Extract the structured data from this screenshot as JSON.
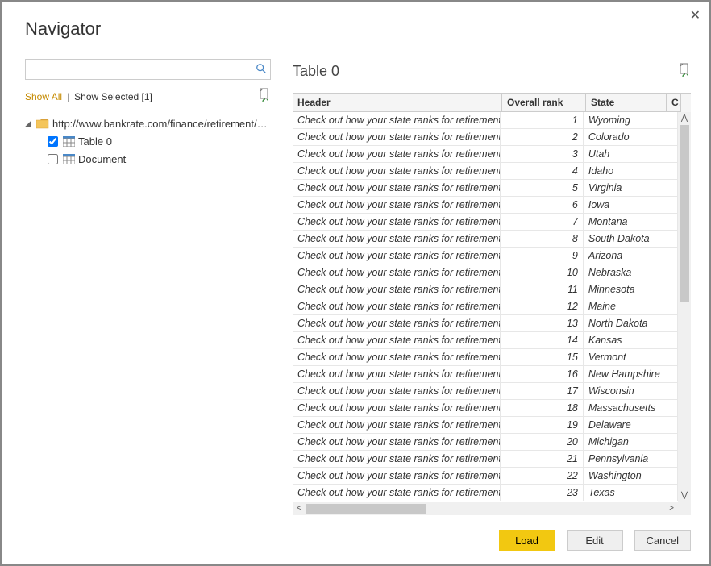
{
  "title": "Navigator",
  "search": {
    "placeholder": ""
  },
  "filter": {
    "show_all": "Show All",
    "show_selected": "Show Selected [1]"
  },
  "tree": {
    "root_label": "http://www.bankrate.com/finance/retirement/be...",
    "items": [
      {
        "label": "Table 0",
        "checked": true
      },
      {
        "label": "Document",
        "checked": false
      }
    ]
  },
  "preview": {
    "title": "Table 0",
    "columns": [
      "Header",
      "Overall rank",
      "State",
      "Co"
    ],
    "rows": [
      {
        "header": "Check out how your state ranks for retirement",
        "rank": 1,
        "state": "Wyoming"
      },
      {
        "header": "Check out how your state ranks for retirement",
        "rank": 2,
        "state": "Colorado"
      },
      {
        "header": "Check out how your state ranks for retirement",
        "rank": 3,
        "state": "Utah"
      },
      {
        "header": "Check out how your state ranks for retirement",
        "rank": 4,
        "state": "Idaho"
      },
      {
        "header": "Check out how your state ranks for retirement",
        "rank": 5,
        "state": "Virginia"
      },
      {
        "header": "Check out how your state ranks for retirement",
        "rank": 6,
        "state": "Iowa"
      },
      {
        "header": "Check out how your state ranks for retirement",
        "rank": 7,
        "state": "Montana"
      },
      {
        "header": "Check out how your state ranks for retirement",
        "rank": 8,
        "state": "South Dakota"
      },
      {
        "header": "Check out how your state ranks for retirement",
        "rank": 9,
        "state": "Arizona"
      },
      {
        "header": "Check out how your state ranks for retirement",
        "rank": 10,
        "state": "Nebraska"
      },
      {
        "header": "Check out how your state ranks for retirement",
        "rank": 11,
        "state": "Minnesota"
      },
      {
        "header": "Check out how your state ranks for retirement",
        "rank": 12,
        "state": "Maine"
      },
      {
        "header": "Check out how your state ranks for retirement",
        "rank": 13,
        "state": "North Dakota"
      },
      {
        "header": "Check out how your state ranks for retirement",
        "rank": 14,
        "state": "Kansas"
      },
      {
        "header": "Check out how your state ranks for retirement",
        "rank": 15,
        "state": "Vermont"
      },
      {
        "header": "Check out how your state ranks for retirement",
        "rank": 16,
        "state": "New Hampshire"
      },
      {
        "header": "Check out how your state ranks for retirement",
        "rank": 17,
        "state": "Wisconsin"
      },
      {
        "header": "Check out how your state ranks for retirement",
        "rank": 18,
        "state": "Massachusetts"
      },
      {
        "header": "Check out how your state ranks for retirement",
        "rank": 19,
        "state": "Delaware"
      },
      {
        "header": "Check out how your state ranks for retirement",
        "rank": 20,
        "state": "Michigan"
      },
      {
        "header": "Check out how your state ranks for retirement",
        "rank": 21,
        "state": "Pennsylvania"
      },
      {
        "header": "Check out how your state ranks for retirement",
        "rank": 22,
        "state": "Washington"
      },
      {
        "header": "Check out how your state ranks for retirement",
        "rank": 23,
        "state": "Texas"
      }
    ]
  },
  "buttons": {
    "load": "Load",
    "edit": "Edit",
    "cancel": "Cancel"
  }
}
